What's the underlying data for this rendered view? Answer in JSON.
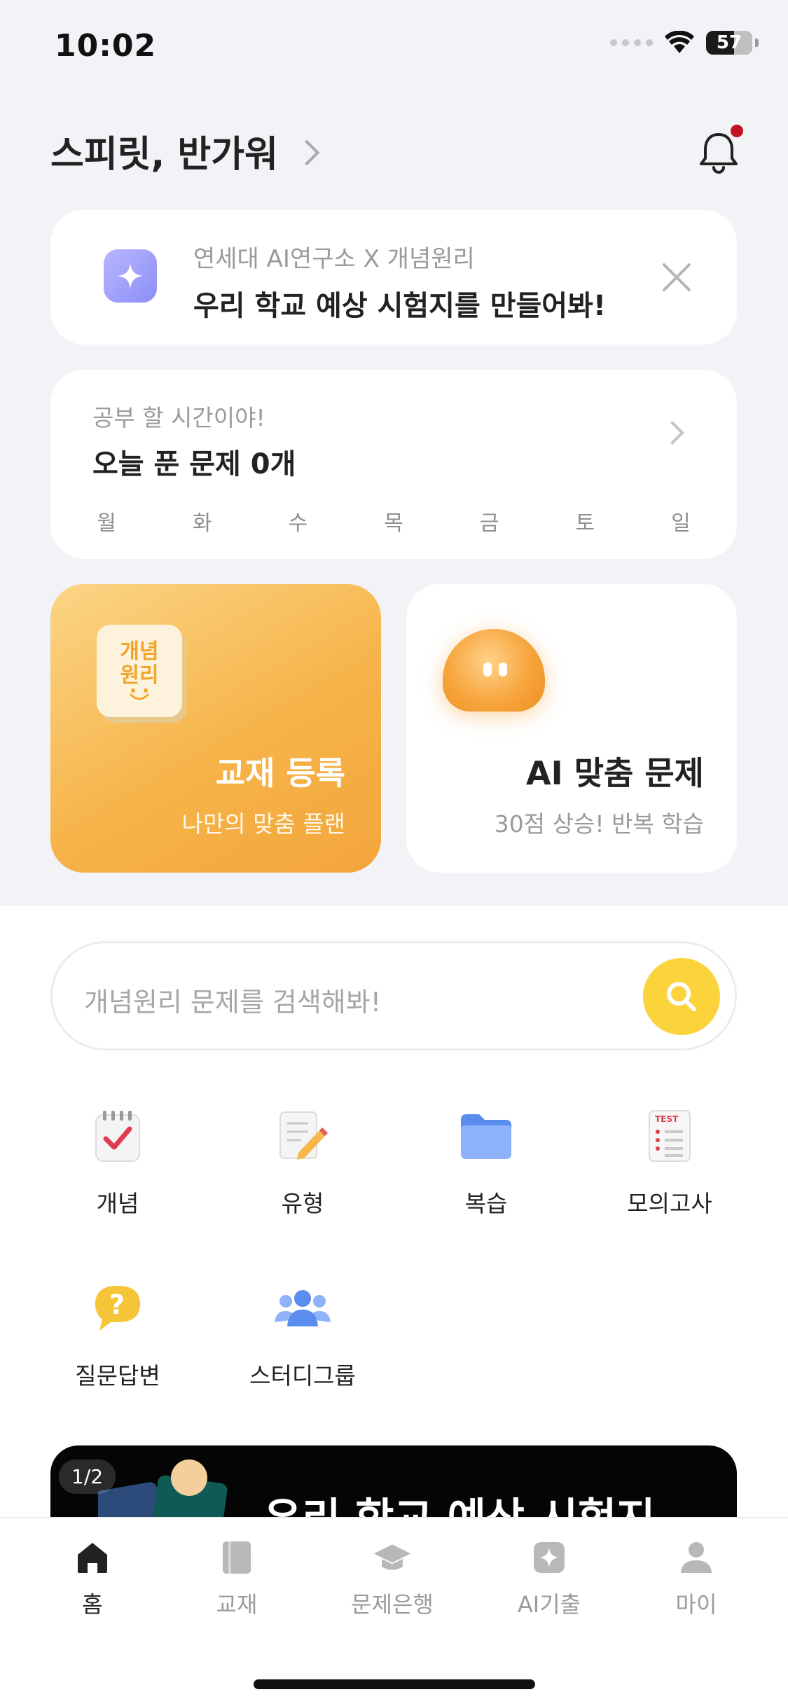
{
  "status_bar": {
    "time": "10:02",
    "battery": "57"
  },
  "header": {
    "greeting": "스피릿, 반가워"
  },
  "promo": {
    "subtitle": "연세대 AI연구소 X 개념원리",
    "title": "우리 학교 예상 시험지를 만들어봐!"
  },
  "study": {
    "subtitle": "공부 할 시간이야!",
    "title": "오늘 푼 문제 0개",
    "weekdays": [
      "월",
      "화",
      "수",
      "목",
      "금",
      "토",
      "일"
    ]
  },
  "textbook_card": {
    "logo_line1": "개념",
    "logo_line2": "원리",
    "title": "교재 등록",
    "subtitle": "나만의 맞춤 플랜"
  },
  "ai_card": {
    "title": "AI 맞춤 문제",
    "subtitle": "30점 상승! 반복 학습"
  },
  "search": {
    "placeholder": "개념원리 문제를 검색해봐!"
  },
  "menu": [
    {
      "label": "개념",
      "icon": "calendar-check-icon"
    },
    {
      "label": "유형",
      "icon": "document-pencil-icon"
    },
    {
      "label": "복습",
      "icon": "folder-icon"
    },
    {
      "label": "모의고사",
      "icon": "test-paper-icon"
    },
    {
      "label": "질문답변",
      "icon": "question-bubble-icon"
    },
    {
      "label": "스터디그룹",
      "icon": "people-group-icon"
    }
  ],
  "banner": {
    "page": "1/2",
    "text": "우리 학교 예상 시험지"
  },
  "tabs": [
    {
      "label": "홈",
      "icon": "home-icon",
      "active": true
    },
    {
      "label": "교재",
      "icon": "book-icon",
      "active": false
    },
    {
      "label": "문제은행",
      "icon": "graduation-cap-icon",
      "active": false
    },
    {
      "label": "AI기출",
      "icon": "ai-sparkle-icon",
      "active": false
    },
    {
      "label": "마이",
      "icon": "person-icon",
      "active": false
    }
  ],
  "colors": {
    "accent_yellow": "#fbd33a",
    "textbook_orange": "#f6b44a",
    "notification_dot": "#c1121f"
  }
}
